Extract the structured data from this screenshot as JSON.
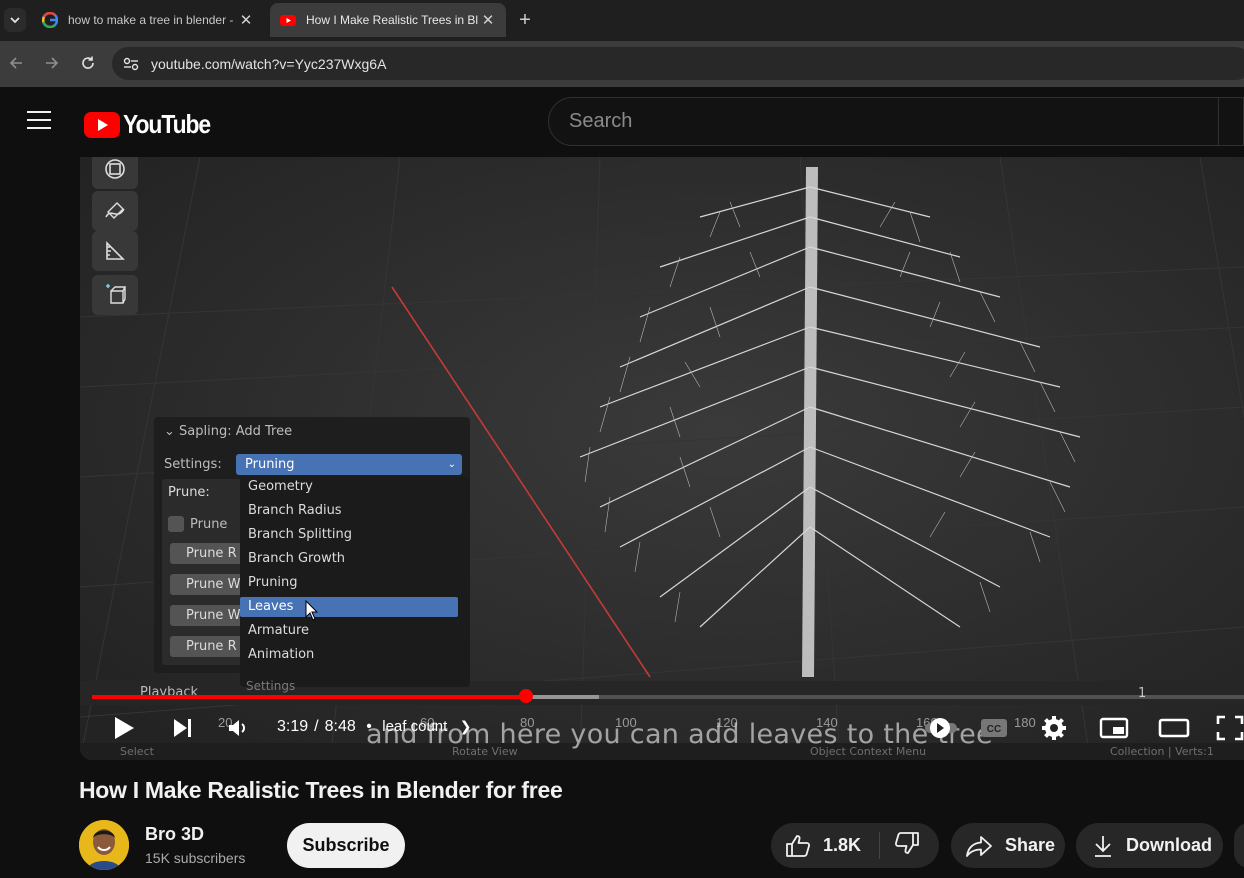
{
  "browser": {
    "tabs": [
      {
        "title": "how to make a tree in blender -",
        "favicon": "google-icon",
        "active": false
      },
      {
        "title": "How I Make Realistic Trees in Bl",
        "favicon": "youtube-icon",
        "active": true
      }
    ],
    "url": "youtube.com/watch?v=Yyc237Wxg6A"
  },
  "masthead": {
    "logo_text": "YouTube",
    "search_placeholder": "Search"
  },
  "player": {
    "sapling_panel": {
      "title": "Sapling: Add Tree",
      "settings_label": "Settings:",
      "settings_value": "Pruning",
      "prune_label": "Prune:",
      "prune_checkbox_label": "Prune",
      "buttons": [
        "Prune R",
        "Prune W",
        "Prune W",
        "Prune R"
      ]
    },
    "dropdown": {
      "items": [
        "Geometry",
        "Branch Radius",
        "Branch Splitting",
        "Branch Growth",
        "Pruning",
        "Leaves",
        "Armature",
        "Animation"
      ],
      "selected": "Leaves",
      "footer": "Settings"
    },
    "timeline": {
      "playback_label": "Playback",
      "frame_value": "1",
      "ticks": [
        "20",
        "60",
        "80",
        "100",
        "120",
        "140",
        "160",
        "180"
      ]
    },
    "status_bar": {
      "left": "Select",
      "middle": "Rotate View",
      "context": "Object Context Menu",
      "right": "Collection | Verts:1"
    },
    "caption": "and from here you can add leaves to the tree",
    "time_current": "3:19",
    "time_total": "8:48",
    "time_separator": "/",
    "chapter": "leaf count",
    "progress": 0.377,
    "buffered": 0.44
  },
  "video": {
    "title": "How I Make Realistic Trees in Blender for free",
    "channel": "Bro 3D",
    "subscribers": "15K subscribers",
    "subscribe_label": "Subscribe",
    "likes": "1.8K",
    "share_label": "Share",
    "download_label": "Download"
  },
  "colors": {
    "youtube_red": "#ff0000",
    "blender_blue": "#4772b3",
    "background": "#0f0f0f"
  }
}
